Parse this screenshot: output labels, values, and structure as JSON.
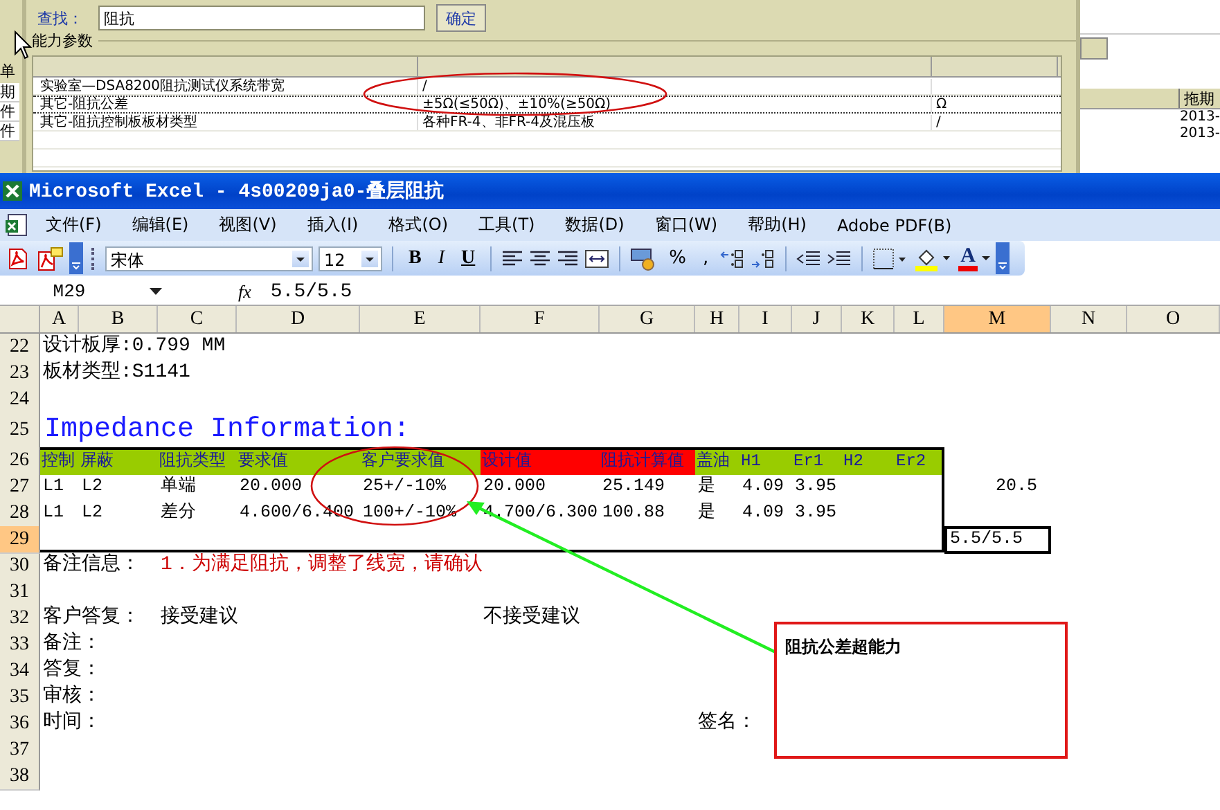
{
  "background_window": {
    "left_edge": [
      "单",
      "期",
      "件",
      "件"
    ],
    "search": {
      "label": "查找：",
      "value": "阻抗",
      "button": "确定"
    },
    "group": {
      "title": "能力参数",
      "rows": [
        {
          "item": "实验室—DSA8200阻抗测试仪系统带宽",
          "value": "/",
          "selected": false
        },
        {
          "item": "其它-阻抗公差",
          "value": "±5Ω(≤50Ω)、±10%(≥50Ω)",
          "unit": "Ω",
          "selected": true
        },
        {
          "item": "其它-阻抗控制板板材类型",
          "value": "各种FR-4、非FR-4及混压板",
          "unit": "/",
          "selected": false
        }
      ]
    },
    "right_panel": {
      "header": "拖期",
      "cells": [
        "2013-",
        "2013-"
      ]
    }
  },
  "excel": {
    "title": "Microsoft Excel - 4s00209ja0-叠层阻抗",
    "menu": [
      "文件(F)",
      "编辑(E)",
      "视图(V)",
      "插入(I)",
      "格式(O)",
      "工具(T)",
      "数据(D)",
      "窗口(W)",
      "帮助(H)",
      "Adobe PDF(B)"
    ],
    "toolbar": {
      "font": "宋体",
      "size": "12",
      "style_buttons": [
        "B",
        "I",
        "U"
      ],
      "number_buttons": [
        "%",
        ","
      ],
      "font_color_label": "A"
    },
    "name_box": "M29",
    "fx": "fx",
    "formula": "5.5/5.5",
    "columns": [
      {
        "label": "A",
        "selected": false
      },
      {
        "label": "B",
        "selected": false
      },
      {
        "label": "C",
        "selected": false
      },
      {
        "label": "D",
        "selected": false
      },
      {
        "label": "E",
        "selected": false
      },
      {
        "label": "F",
        "selected": false
      },
      {
        "label": "G",
        "selected": false
      },
      {
        "label": "H",
        "selected": false
      },
      {
        "label": "I",
        "selected": false
      },
      {
        "label": "J",
        "selected": false
      },
      {
        "label": "K",
        "selected": false
      },
      {
        "label": "L",
        "selected": false
      },
      {
        "label": "M",
        "selected": true
      },
      {
        "label": "N",
        "selected": false
      },
      {
        "label": "O",
        "selected": false
      }
    ],
    "rows": [
      {
        "number": "22",
        "kind": "plain",
        "selected": false,
        "cells": [
          "设计板厚:0.799 MM"
        ]
      },
      {
        "number": "23",
        "kind": "plain",
        "selected": false,
        "cells": [
          "板材类型:S1141"
        ]
      },
      {
        "number": "24",
        "kind": "plain",
        "selected": false,
        "cells": []
      },
      {
        "number": "25",
        "kind": "title",
        "selected": false,
        "cells": [
          "Impedance Information:"
        ]
      },
      {
        "number": "26",
        "kind": "table-head",
        "selected": false,
        "cells": [
          {
            "text": "控制",
            "color": "#99cc00"
          },
          {
            "text": "屏蔽",
            "color": "#99cc00"
          },
          {
            "text": "阻抗类型",
            "color": "#99cc00"
          },
          {
            "text": "要求值",
            "color": "#99cc00"
          },
          {
            "text": "客户要求值",
            "color": "#99cc00"
          },
          {
            "text": "设计值",
            "color": "#ff0000"
          },
          {
            "text": "阻抗计算值",
            "color": "#ff0000"
          },
          {
            "text": "盖油",
            "color": "#99cc00"
          },
          {
            "text": "H1",
            "color": "#99cc00"
          },
          {
            "text": "Er1",
            "color": "#99cc00"
          },
          {
            "text": "H2",
            "color": "#99cc00"
          },
          {
            "text": "Er2",
            "color": "#99cc00"
          }
        ]
      },
      {
        "number": "27",
        "kind": "table-row",
        "selected": false,
        "cells": [
          "L1",
          "L2",
          "单端",
          "20.000",
          "25+/-10%",
          "20.000",
          "25.149",
          "是",
          "4.09",
          "3.95",
          "",
          "",
          {
            "text": "20.5",
            "kind": "number"
          }
        ]
      },
      {
        "number": "28",
        "kind": "table-row",
        "selected": false,
        "cells": [
          "L1",
          "L2",
          "差分",
          "4.600/6.400",
          "100+/-10%",
          "4.700/6.300",
          "100.88",
          "是",
          "4.09",
          "3.95"
        ]
      },
      {
        "number": "29",
        "kind": "table-row",
        "selected": true,
        "cells": [
          "",
          "",
          "",
          "",
          "",
          "",
          "",
          "",
          "",
          "",
          "",
          "",
          "5.5/5.5"
        ]
      },
      {
        "number": "30",
        "kind": "plain",
        "selected": false,
        "cells": [
          "备注信息：",
          "",
          {
            "text": "1．为满足阻抗，调整了线宽，请确认",
            "color": "#cc0000"
          }
        ]
      },
      {
        "number": "31",
        "kind": "plain",
        "selected": false,
        "cells": []
      },
      {
        "number": "32",
        "kind": "plain",
        "selected": false,
        "cells": [
          "客户答复：",
          "",
          "接受建议",
          "",
          "",
          "不接受建议"
        ]
      },
      {
        "number": "33",
        "kind": "plain",
        "selected": false,
        "cells": [
          "备注："
        ]
      },
      {
        "number": "34",
        "kind": "plain",
        "selected": false,
        "cells": [
          "答复："
        ]
      },
      {
        "number": "35",
        "kind": "plain",
        "selected": false,
        "cells": [
          "审核："
        ]
      },
      {
        "number": "36",
        "kind": "plain",
        "selected": false,
        "cells": [
          "时间：",
          "",
          "",
          "",
          "",
          "",
          "",
          "签名："
        ]
      },
      {
        "number": "37",
        "kind": "plain",
        "selected": false,
        "cells": []
      },
      {
        "number": "38",
        "kind": "plain",
        "selected": false,
        "cells": []
      }
    ],
    "comment": {
      "text": "阻抗公差超能力"
    }
  }
}
